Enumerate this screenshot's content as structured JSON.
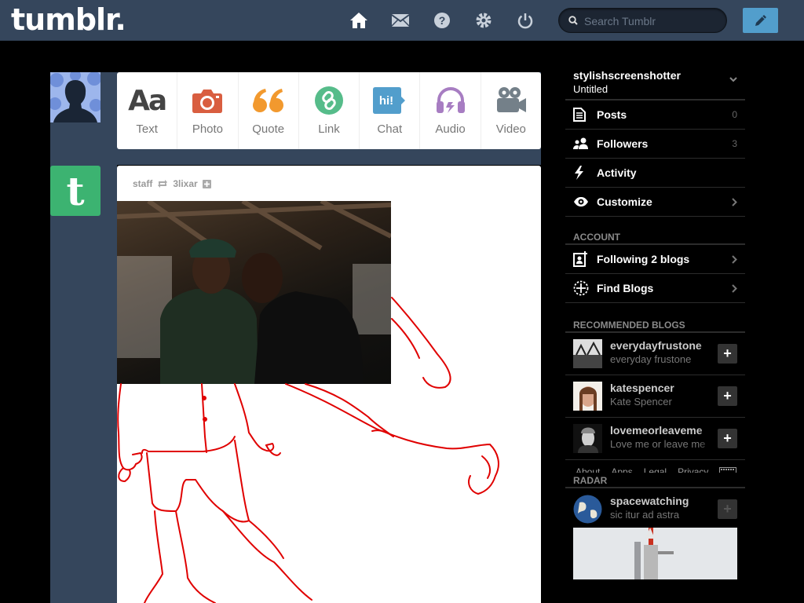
{
  "header": {
    "logo": "tumblr.",
    "nav_icons": [
      "home-icon",
      "mail-icon",
      "help-icon",
      "gear-icon",
      "power-icon"
    ],
    "search_placeholder": "Search Tumblr",
    "compose_icon": "pencil-icon"
  },
  "post_types": [
    {
      "label": "Text",
      "icon": "text-icon",
      "color": "#444444"
    },
    {
      "label": "Photo",
      "icon": "camera-icon",
      "color": "#d95e40"
    },
    {
      "label": "Quote",
      "icon": "quote-icon",
      "color": "#f2992e"
    },
    {
      "label": "Link",
      "icon": "link-icon",
      "color": "#56bc8a"
    },
    {
      "label": "Chat",
      "icon": "chat-icon",
      "color": "#529ecc",
      "bubble_text": "hi!"
    },
    {
      "label": "Audio",
      "icon": "headphones-icon",
      "color": "#a77dc2"
    },
    {
      "label": "Video",
      "icon": "video-camera-icon",
      "color": "#748089"
    }
  ],
  "post": {
    "author": "staff",
    "reblogged_from": "3lixar",
    "staff_avatar_letter": "t"
  },
  "sidebar": {
    "blog_name": "stylishscreenshotter",
    "blog_title": "Untitled",
    "menu": [
      {
        "label": "Posts",
        "count": "0",
        "icon": "document-icon"
      },
      {
        "label": "Followers",
        "count": "3",
        "icon": "people-icon"
      },
      {
        "label": "Activity",
        "icon": "lightning-icon"
      },
      {
        "label": "Customize",
        "icon": "eye-icon"
      }
    ],
    "account_title": "ACCOUNT",
    "account_items": [
      {
        "label": "Following 2 blogs",
        "icon": "person-add-icon"
      },
      {
        "label": "Find Blogs",
        "icon": "compass-icon"
      }
    ],
    "recommended_title": "RECOMMENDED BLOGS",
    "recommended": [
      {
        "name": "everydayfrustone",
        "title": "everyday frustone"
      },
      {
        "name": "katespencer",
        "title": "Kate Spencer"
      },
      {
        "name": "lovemeorleaveme",
        "title": "Love me or leave me"
      }
    ],
    "footer_links": [
      "About",
      "Apps",
      "Legal",
      "Privacy"
    ],
    "radar_title": "RADAR",
    "radar": {
      "name": "spacewatching",
      "title": "sic itur ad astra"
    }
  },
  "colors": {
    "header_bg": "#35465c",
    "compose_bg": "#529ecc",
    "staff_green": "#3cb371",
    "sketch_red": "#e00000"
  }
}
